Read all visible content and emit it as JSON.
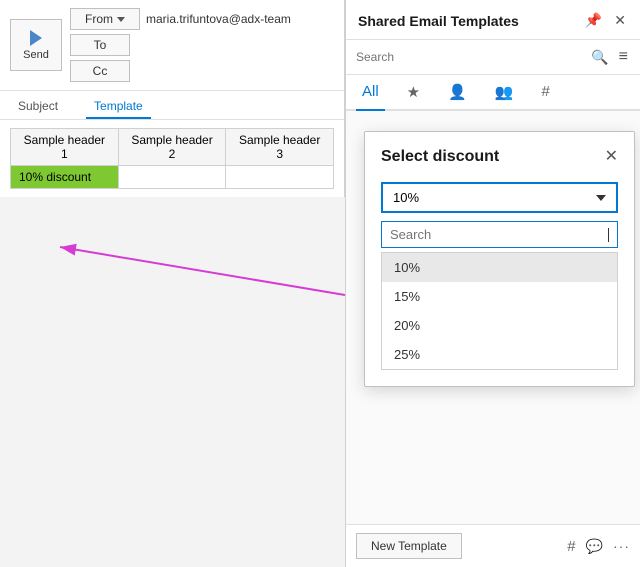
{
  "email": {
    "send_label": "Send",
    "from_label": "From",
    "to_label": "To",
    "cc_label": "Cc",
    "from_value": "maria.trifuntova@adx-team",
    "subject_tab": "Subject",
    "template_tab": "Template"
  },
  "table": {
    "headers": [
      "Sample header 1",
      "Sample header 2",
      "Sample header 3"
    ],
    "row1": [
      "10% discount",
      "",
      ""
    ]
  },
  "panel": {
    "title": "Shared Email Templates",
    "search_placeholder": "Search",
    "tabs": [
      "All",
      "★",
      "👤",
      "👥",
      "#"
    ],
    "footer": {
      "new_template_label": "New Template"
    }
  },
  "modal": {
    "title": "Select discount",
    "selected_value": "10%",
    "search_placeholder": "Search",
    "options": [
      "10%",
      "15%",
      "20%",
      "25%"
    ]
  },
  "icons": {
    "send_arrow": "→",
    "close": "✕",
    "pin": "📌",
    "search": "🔍",
    "filter": "≡",
    "hash": "#",
    "comment": "💬",
    "more": "···"
  }
}
